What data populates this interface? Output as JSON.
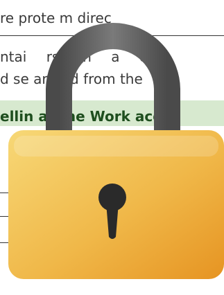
{
  "document": {
    "line1": "re prote            m direc",
    "line2": "ntai   rs   in   a      ck",
    "line3": "d se    arated from    the",
    "line4": "ellin   at the Work    ace"
  },
  "colors": {
    "band": "#d7e9cf",
    "heading": "#1e4e1e",
    "lock_body_top": "#f7d877",
    "lock_body_bottom": "#e69422",
    "shackle": "#5c5c5c",
    "keyhole": "#2a2a2a"
  },
  "icon": "padlock-icon"
}
